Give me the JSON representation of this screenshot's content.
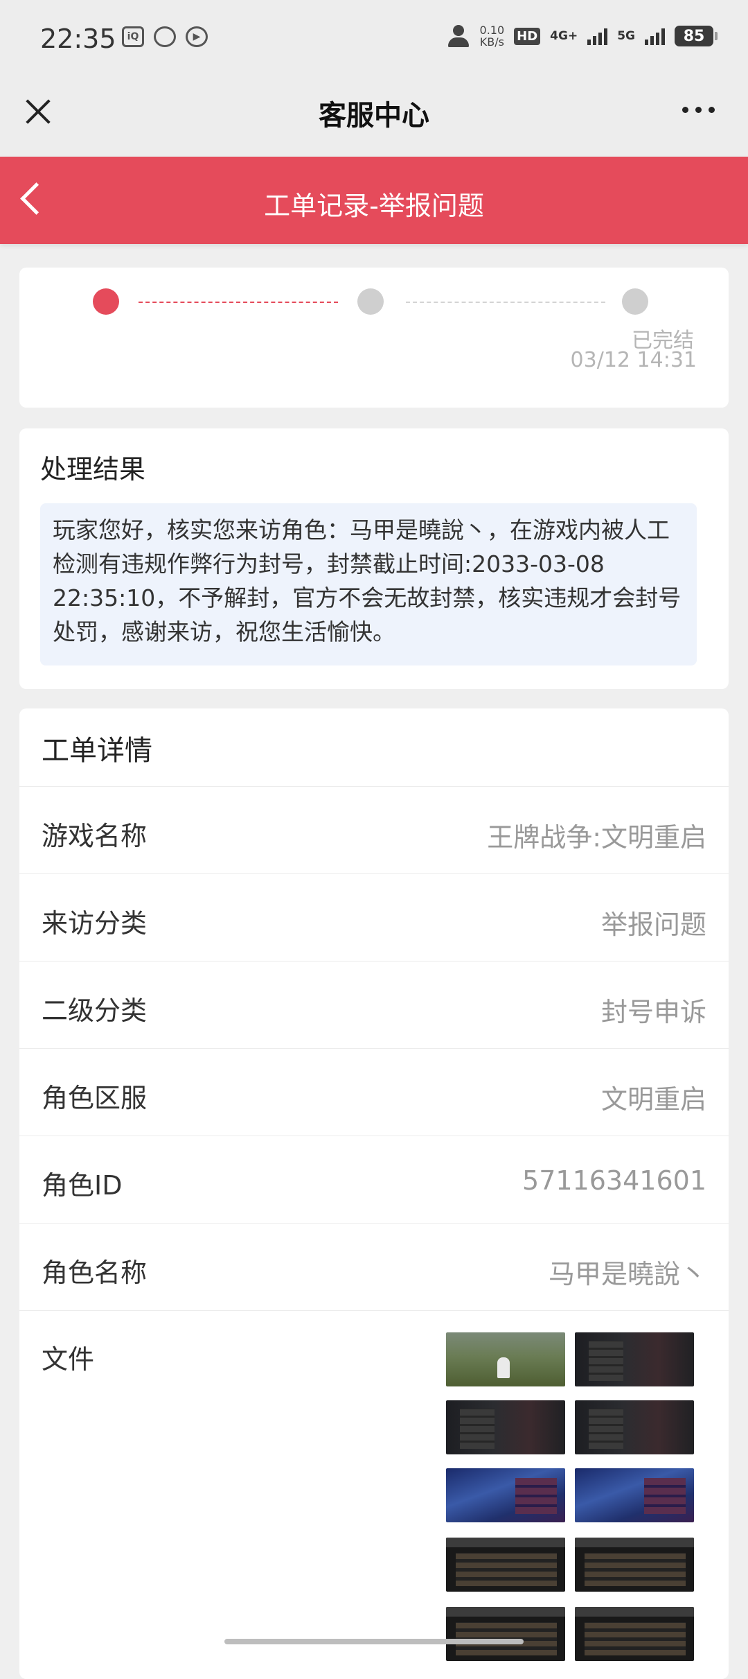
{
  "status_bar": {
    "time": "22:35",
    "left_icons": [
      "iqiyi-icon",
      "browser-icon",
      "video-play-icon"
    ],
    "net_speed_top": "0.10",
    "net_speed_bottom": "KB/s",
    "hd_label": "HD",
    "net_4g": "4G+",
    "net_5g": "5G",
    "battery": "85"
  },
  "titlebar": {
    "title": "客服中心"
  },
  "header": {
    "title": "工单记录-举报问题"
  },
  "progress": {
    "status": "已完结",
    "time": "03/12 14:31"
  },
  "result": {
    "title": "处理结果",
    "text": "玩家您好，核实您来访角色：马甲是曉說丶，在游戏内被人工检测有违规作弊行为封号，封禁截止时间:2033-03-08 22:35:10，不予解封，官方不会无故封禁，核实违规才会封号处罚，感谢来访，祝您生活愉快。"
  },
  "detail": {
    "title": "工单详情",
    "rows": [
      {
        "label": "游戏名称",
        "value": "王牌战争:文明重启"
      },
      {
        "label": "来访分类",
        "value": "举报问题"
      },
      {
        "label": "二级分类",
        "value": "封号申诉"
      },
      {
        "label": "角色区服",
        "value": "文明重启"
      },
      {
        "label": "角色ID",
        "value": "57116341601"
      },
      {
        "label": "角色名称",
        "value": "马甲是曉說丶"
      }
    ],
    "files_label": "文件"
  },
  "colors": {
    "accent": "#e54b5b",
    "result_bg": "#eef3fc",
    "page_bg": "#efefef"
  }
}
